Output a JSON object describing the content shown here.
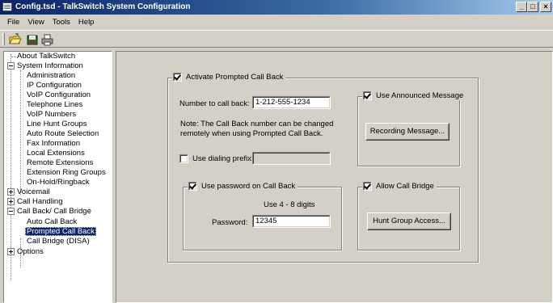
{
  "window": {
    "title": "Config.tsd - TalkSwitch System Configuration",
    "icon": "app-window-icon",
    "controls": {
      "minimize": "_",
      "maximize": "□",
      "close": "×"
    }
  },
  "menu": {
    "file": "File",
    "view": "View",
    "tools": "Tools",
    "help": "Help"
  },
  "toolbar": {
    "icons": [
      "open-folder-icon",
      "save-disk-icon",
      "print-icon"
    ]
  },
  "tree": {
    "items": [
      {
        "label": "About TalkSwitch"
      },
      {
        "label": "System Information",
        "expander": "-"
      },
      {
        "label": "Administration"
      },
      {
        "label": "IP Configuration"
      },
      {
        "label": "VoIP Configuration"
      },
      {
        "label": "Telephone Lines"
      },
      {
        "label": "VoIP Numbers"
      },
      {
        "label": "Line Hunt Groups"
      },
      {
        "label": "Auto Route Selection"
      },
      {
        "label": "Fax Information"
      },
      {
        "label": "Local Extensions"
      },
      {
        "label": "Remote Extensions"
      },
      {
        "label": "Extension Ring Groups"
      },
      {
        "label": "On-Hold/Ringback"
      },
      {
        "label": "Voicemail",
        "expander": "+"
      },
      {
        "label": "Call Handling",
        "expander": "+"
      },
      {
        "label": "Call Back/ Call Bridge",
        "expander": "-"
      },
      {
        "label": "Auto Call Back"
      },
      {
        "label": "Prompted Call Back",
        "selected": true
      },
      {
        "label": "Call Bridge (DISA)"
      },
      {
        "label": "Options",
        "expander": "+"
      }
    ]
  },
  "prompted_call_back": {
    "activate_label": "Activate Prompted Call Back",
    "activate_checked": true,
    "number_label": "Number to call back:",
    "number_value": "1-212-555-1234",
    "note_line1": "Note: The Call Back number can be changed",
    "note_line2": "remotely when using Prompted Call Back.",
    "dialing_prefix_label": "Use dialing prefix:",
    "dialing_prefix_checked": false,
    "dialing_prefix_value": "",
    "announced_label": "Use Announced Message",
    "announced_checked": true,
    "recording_button": "Recording Message...",
    "password_group_label": "Use password on Call Back",
    "password_checked": true,
    "password_hint": "Use 4 - 8 digits",
    "password_label": "Password:",
    "password_value": "12345",
    "bridge_label": "Allow Call Bridge",
    "bridge_checked": true,
    "hunt_button": "Hunt Group Access..."
  }
}
